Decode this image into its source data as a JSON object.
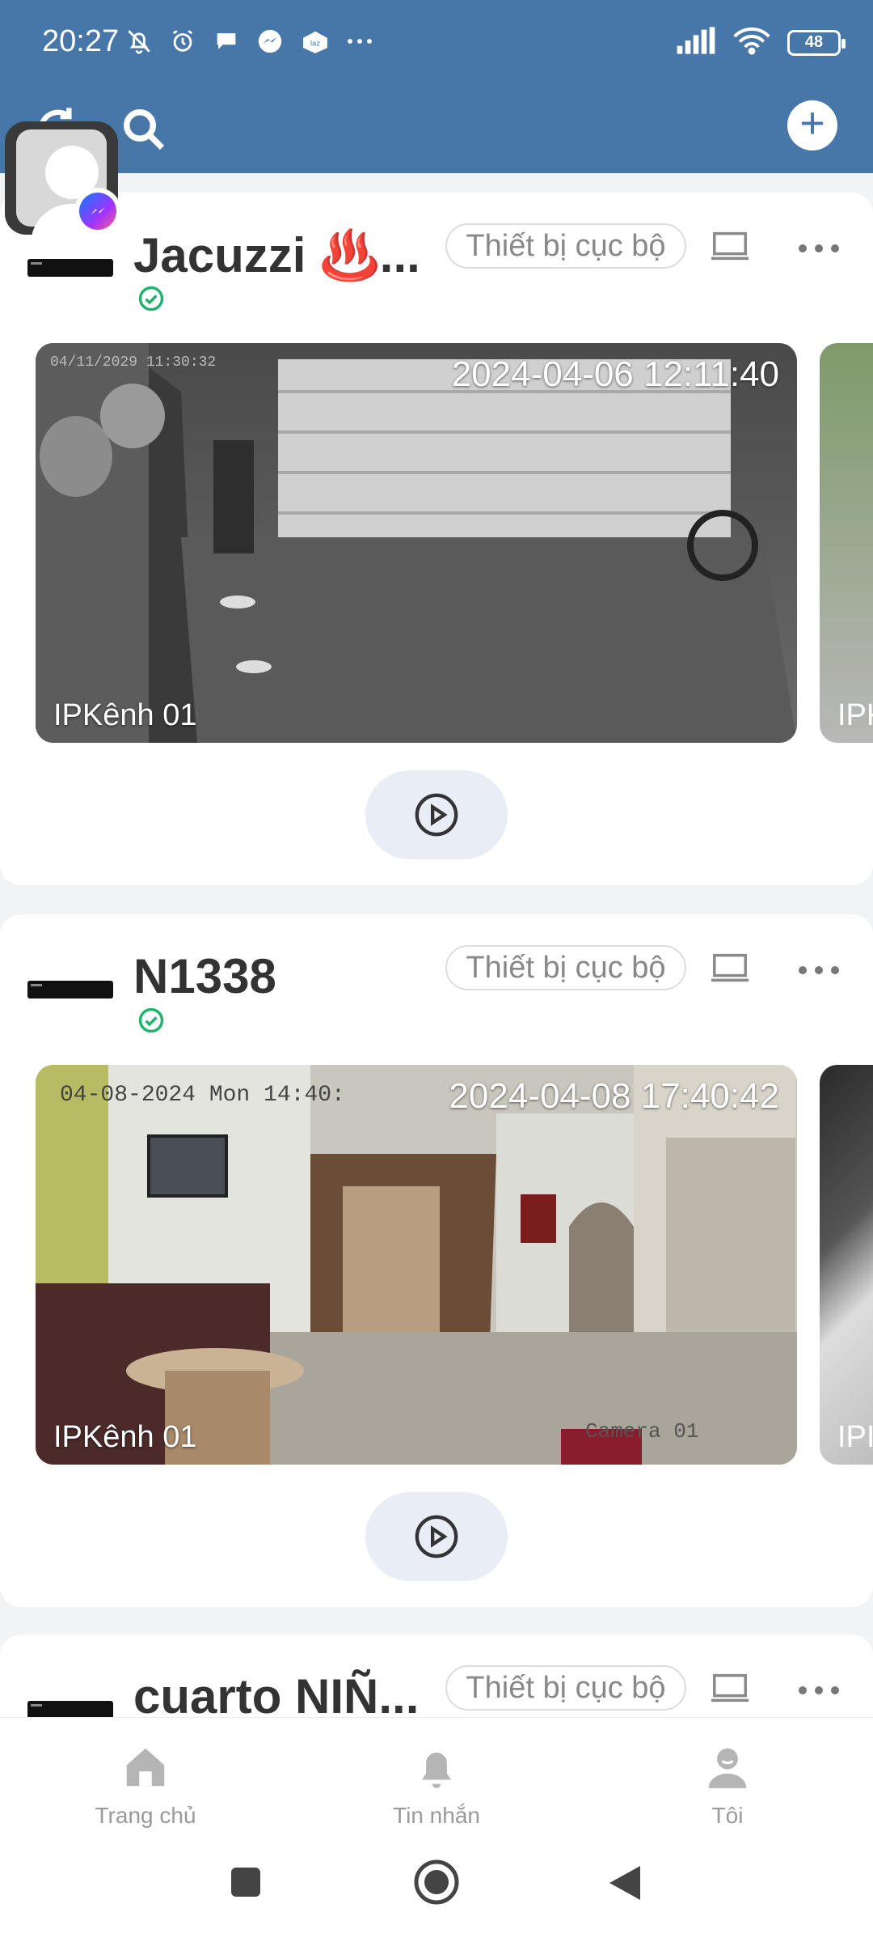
{
  "status_bar": {
    "time": "20:27",
    "battery": "48"
  },
  "header": {
    "add_symbol": "+"
  },
  "local_tag_label": "Thiết bị cục bộ",
  "devices": [
    {
      "name": "Jacuzzi ♨️...",
      "online": true,
      "tiles": [
        {
          "timestamp": "2024-04-06 12:11:40",
          "overlay_text": "04/11/2029 11:30:32",
          "channel": "IPKênh 01"
        },
        {
          "channel_peek": "IPK"
        }
      ]
    },
    {
      "name": "N1338",
      "online": true,
      "tiles": [
        {
          "timestamp": "2024-04-08 17:40:42",
          "overlay_text": "04-08-2024 Mon 14:40:",
          "camera_label": "Camera 01",
          "channel": "IPKênh 01"
        },
        {
          "channel_peek": "IPI"
        }
      ]
    },
    {
      "name": "cuarto NIÑ..."
    }
  ],
  "bottom_nav": {
    "home": "Trang chủ",
    "messages": "Tin nhắn",
    "me": "Tôi"
  }
}
